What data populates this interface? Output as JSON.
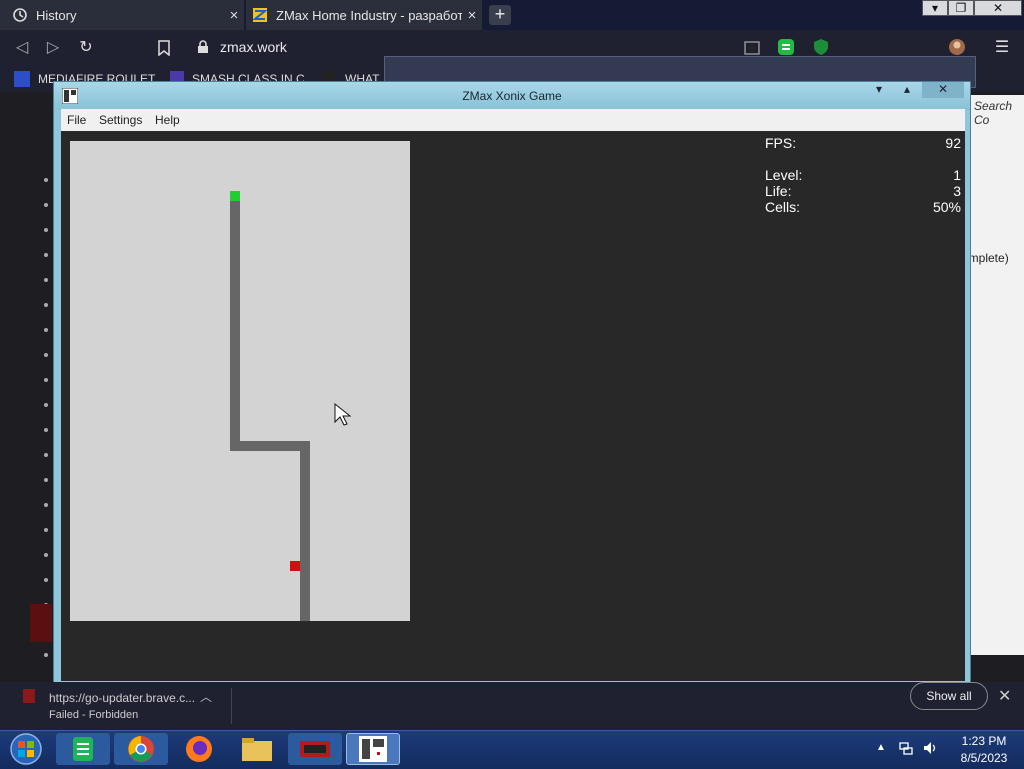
{
  "browser": {
    "tabs": [
      {
        "label": "History"
      },
      {
        "label": "ZMax Home Industry - разработка"
      }
    ],
    "new_tab_symbol": "+",
    "url": "zmax.work",
    "bookmarks": [
      "MEDIAFIRE ROULET",
      "SMASH CLASS IN C",
      "WHAT"
    ],
    "window_controls": {
      "minimize": "▾",
      "restore": "❐",
      "close": "✕"
    }
  },
  "background_page": {
    "search_placeholder": "Search Co",
    "complete_text": "omplete)"
  },
  "game_window": {
    "title": "ZMax Xonix Game",
    "menu": [
      "File",
      "Settings",
      "Help"
    ],
    "controls": {
      "minimize": "▾",
      "maximize": "▴",
      "close": "✕"
    },
    "stats": {
      "fps_label": "FPS:",
      "fps_value": "92",
      "level_label": "Level:",
      "level_value": "1",
      "life_label": "Life:",
      "life_value": "3",
      "cells_label": "Cells:",
      "cells_value": "50%"
    }
  },
  "download_bar": {
    "file_url": "https://go-updater.brave.c...",
    "status": "Failed - Forbidden",
    "show_all": "Show all",
    "close_symbol": "✕"
  },
  "taskbar": {
    "time": "1:23 PM",
    "date": "8/5/2023"
  },
  "colors": {
    "field": "#d3d3d3",
    "trail": "#666666",
    "player": "#22cc33",
    "enemy": "#cc1111",
    "client_bg": "#282828"
  }
}
